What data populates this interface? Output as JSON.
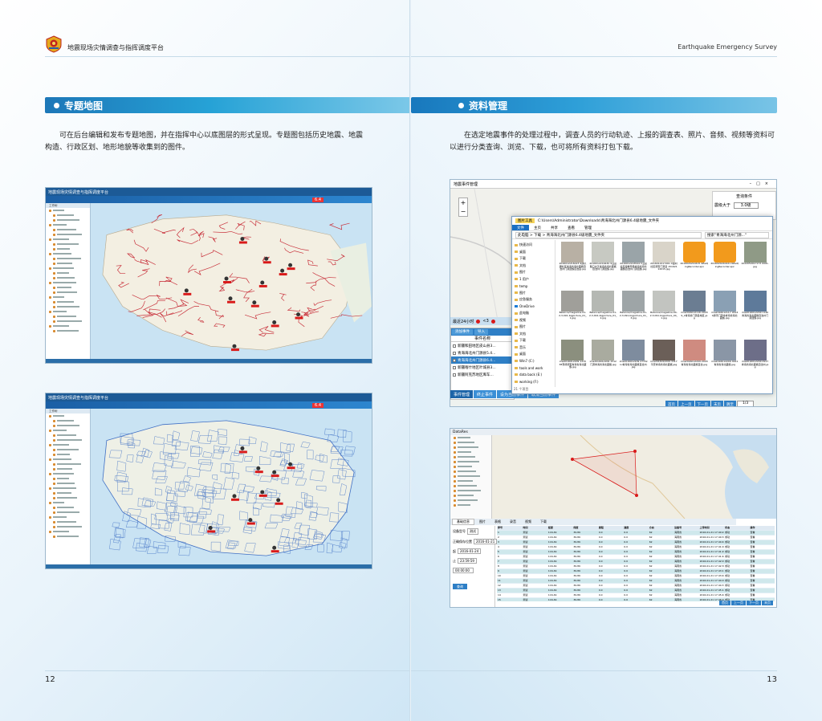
{
  "header": {
    "brand_cn": "地震现场灾情调查与指挥调度平台",
    "brand_en": "Earthquake Emergency Survey"
  },
  "left_page": {
    "section_title": "专题地图",
    "paragraph": "可在后台编辑和发布专题地图，并在指挥中心以底图层的形式呈现。专题图包括历史地震、地震构造、行政区划、地形地貌等收集到的图件。",
    "page_number": "12",
    "screenshot1": {
      "app_title": "地震现场灾情调查与指挥调度平台",
      "magnitude": "6.4",
      "tree_header": "工作树"
    },
    "screenshot2": {
      "app_title": "地震现场灾情调查与指挥调度平台",
      "magnitude": "6.4",
      "tree_header": "工作树"
    }
  },
  "right_page": {
    "section_title": "资料管理",
    "paragraph": "在选定地震事件的处理过程中，调查人员的行动轨迹、上报的调查表、照片、音频、视频等资料可以进行分类查询、浏览、下载，也可将所有资料打包下载。",
    "page_number": "13",
    "screenshot3": {
      "window_title": "地震事件管理",
      "query_header": "查询条件",
      "magnitude_filter_label": "震级大于",
      "magnitude_filter_value": "3.0级",
      "recent_label": "最近24小时",
      "count_label": "<3",
      "list_buttons": [
        "添加事件",
        "导入"
      ],
      "list_header": "事件名称",
      "events": [
        "新疆和田地区皮山县3...",
        "青海海北州门源县5.4...",
        "青海海北州门源县6.4...",
        "新疆喀什地区叶城县3...",
        "新疆阿克苏地区库车..."
      ],
      "bottom_tabs": [
        "事件管理",
        "终止事件",
        "设为当前事件",
        "取消当前事件"
      ],
      "pager_buttons": [
        "首页",
        "上一页",
        "下一页",
        "末页",
        "跳至"
      ],
      "pager_value": "1/3",
      "explorer": {
        "ribbon_tabs": [
          "文件",
          "主页",
          "共享",
          "查看",
          "管理"
        ],
        "picture_tools": "图片工具",
        "path": "C:\\Users\\Administrator\\Downloads\\青海海北州门源县6.4级地震_文件夹",
        "breadcrumb": "此电脑 > 下载 > 青海海北州门源县6.4级地震_文件夹",
        "search_placeholder": "搜索\"青海海北州门源...\"",
        "nav_items": [
          "快速访问",
          "桌面",
          "下载",
          "文档",
          "图片",
          "1 用户",
          "temp",
          "图片",
          "应急服务",
          "OneDrive",
          "此电脑",
          "视频",
          "图片",
          "文档",
          "下载",
          "音乐",
          "桌面",
          "Win7 (C:)",
          "tools and work",
          "data back (E:)",
          "working (F:)"
        ],
        "thumbs": [
          "2016012216023 9通讯器社区青海省海北藏族自治州门源回族自治县.jpg",
          "2016012216430 9沿途路口交叉青海省海北藏族自治州门源回族.jpg",
          "2016012216544 5沿途社区搜救现场青海省海北藏族自治州门源回族.jpg",
          "2016012217261 0金村社区调查门源县 15162112015.jpg",
          "2016020210415 4ZaiQingRecorder.spx",
          "2016020210421 6ZaiQingRecorder.spx",
          "1022050017173 0001.jpg",
          "Balance/magazine-01-2,3,091-bigpicture_01_1.jpg",
          "Balance/magazine-01-2,3,091-bigpicture_01_2.jpg",
          "Balance/magazine-01-2,3,091-bigpicture_01_3.jpg",
          "Balance/magazine-04-2,3,091-bigpicture_04_1.jpg",
          "ima2016012116 20189_2青海省门源县地区.jpg",
          "ima2016012117 05140通讯门源市青海省海北藏族.jpg",
          "ima2016012209 1140青海省海北藏族自治州门源回族.jpg",
          "ima2016012209 121538现场调查青海省海北藏族.jpg",
          "ima2016012209 1512门源青海省海北藏族.jpg",
          "ima2016012209 2733zou青海省海北藏族自治州.jpg",
          "ima2016012209 3317平安青海省海北藏族.jpg",
          "ima2016012209 2418青海省海北藏族自治.jpg",
          "ima2016012209 4911青海省海北藏族.jpg",
          "ima2016012209 4917青海省海北藏族自治州.jpg"
        ],
        "status": "21 个项目"
      }
    },
    "screenshot4": {
      "window_title": "DataRes",
      "query_labels": [
        "设备型号",
        "正确保存位置",
        "起",
        "止"
      ],
      "query_values": [
        "测试",
        "2016-01-21",
        "2016-01-24",
        "23:59:59",
        "00:00:00"
      ],
      "query_button": "查询",
      "tabs": [
        "基础信息",
        "图片",
        "表格",
        "录音",
        "视频",
        "下载"
      ],
      "table_headers": [
        "序号",
        "时间",
        "经度",
        "纬度",
        "高程",
        "速度",
        "方向",
        "设备号",
        "上传时间",
        "状态",
        "操作"
      ],
      "rows": [
        [
          "1",
          "测试",
          "116.49",
          "39.89",
          "0.0",
          "0.0",
          "62",
          "海南省",
          "2016-01-21 17:40:22",
          "成功",
          "查看"
        ],
        [
          "2",
          "测试",
          "116.49",
          "39.89",
          "0.0",
          "0.0",
          "62",
          "海南省",
          "2016-01-21 17:40:33",
          "成功",
          "查看"
        ],
        [
          "3",
          "测试",
          "116.49",
          "39.89",
          "0.0",
          "0.0",
          "62",
          "海南省",
          "2016-01-21 17:40:45",
          "成功",
          "查看"
        ],
        [
          "4",
          "测试",
          "116.49",
          "39.89",
          "0.0",
          "0.0",
          "62",
          "海南省",
          "2016-01-21 17:41:02",
          "成功",
          "查看"
        ],
        [
          "5",
          "测试",
          "116.49",
          "39.89",
          "0.0",
          "0.0",
          "62",
          "海南省",
          "2016-01-21 17:41:20",
          "成功",
          "查看"
        ],
        [
          "6",
          "测试",
          "116.49",
          "39.89",
          "0.0",
          "0.0",
          "62",
          "海南省",
          "2016-01-21 17:41:48",
          "成功",
          "查看"
        ],
        [
          "7",
          "测试",
          "116.49",
          "39.89",
          "0.0",
          "0.0",
          "62",
          "海南省",
          "2016-01-21 17:42:07",
          "成功",
          "查看"
        ],
        [
          "8",
          "测试",
          "116.49",
          "39.89",
          "0.0",
          "0.0",
          "62",
          "海南省",
          "2016-01-21 17:42:30",
          "成功",
          "查看"
        ],
        [
          "9",
          "测试",
          "116.49",
          "39.89",
          "0.0",
          "0.0",
          "62",
          "海南省",
          "2016-01-21 17:43:11",
          "成功",
          "查看"
        ],
        [
          "10",
          "测试",
          "116.49",
          "39.89",
          "0.0",
          "0.0",
          "62",
          "海南省",
          "2016-01-21 17:43:40",
          "成功",
          "查看"
        ],
        [
          "11",
          "测试",
          "116.49",
          "39.89",
          "0.0",
          "0.0",
          "62",
          "海南省",
          "2016-01-21 17:44:05",
          "成功",
          "查看"
        ],
        [
          "12",
          "测试",
          "116.49",
          "39.89",
          "0.0",
          "0.0",
          "62",
          "海南省",
          "2016-01-21 17:44:31",
          "成功",
          "查看"
        ],
        [
          "13",
          "测试",
          "116.49",
          "39.89",
          "0.0",
          "0.0",
          "62",
          "海南省",
          "2016-01-21 17:45:12",
          "成功",
          "查看"
        ],
        [
          "14",
          "测试",
          "116.49",
          "39.89",
          "0.0",
          "0.0",
          "62",
          "海南省",
          "2016-01-21 17:45:40",
          "成功",
          "查看"
        ],
        [
          "15",
          "测试",
          "116.49",
          "39.89",
          "0.0",
          "0.0",
          "62",
          "海南省",
          "2016-01-21 17:46:02",
          "成功",
          "查看"
        ]
      ],
      "pager_buttons": [
        "首页",
        "上一页",
        "下一页",
        "末页"
      ]
    }
  },
  "colors": {
    "accent_blue": "#1d77b8",
    "light_blue": "#7cc8e8",
    "marker_red": "#d91a1a",
    "fault_red": "#c8323c",
    "admin_blue": "#3f6fc4"
  }
}
